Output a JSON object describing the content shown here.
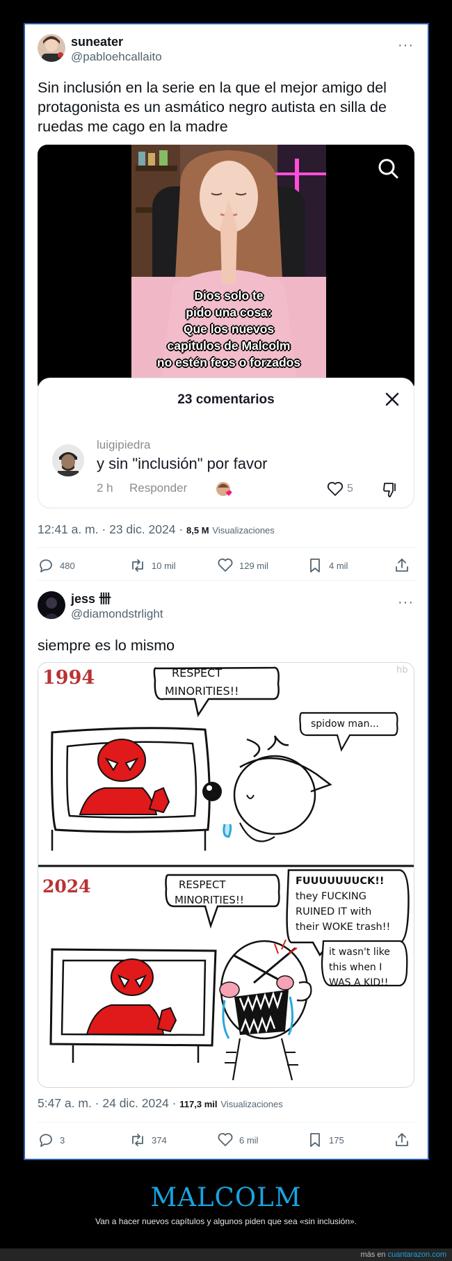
{
  "tweet1": {
    "display_name": "suneater",
    "handle": "@pabloehcallaito",
    "more_label": "···",
    "text": "Sin inclusión en la serie en la que el mejor amigo del protagonista es un asmático negro autista en silla de ruedas me cago en la madre",
    "video_caption": [
      "Dios solo te",
      "pido una cosa:",
      "Que los nuevos",
      "capitulos de Malcolm",
      "no estén feos o forzados"
    ],
    "comments_sheet": {
      "title": "23 comentarios",
      "comment": {
        "user": "luigipiedra",
        "text": "y sin \"inclusión\" por favor",
        "time": "2 h",
        "reply_label": "Responder",
        "likes": "5"
      }
    },
    "timestamp": "12:41 a. m. · 23 dic. 2024 · ",
    "views": "8,5 M",
    "views_label": "Visualizaciones",
    "stats": {
      "replies": "480",
      "retweets": "10 mil",
      "likes": "129 mil",
      "bookmarks": "4 mil"
    }
  },
  "tweet2": {
    "display_name": "jess 卌",
    "handle": "@diamondstrlight",
    "more_label": "···",
    "text": "siempre es lo mismo",
    "comic": {
      "year_top": "1994",
      "year_bottom": "2024",
      "bubble1": [
        "RESPECT",
        "MINORITIES!!"
      ],
      "bubble2": "spidow man...",
      "bubble3": [
        "RESPECT",
        "MINORITIES!!"
      ],
      "bubble4": [
        "FUUUUUUUCK!!",
        "they FUCKING",
        "RUINED IT with",
        "their WOKE trash!!"
      ],
      "bubble5": [
        "it wasn't like",
        "this when I",
        "WAS A KID!!"
      ],
      "watermark": "hb"
    },
    "timestamp": "5:47 a. m. · 24 dic. 2024 · ",
    "views": "117,3 mil",
    "views_label": "Visualizaciones",
    "stats": {
      "replies": "3",
      "retweets": "374",
      "likes": "6 mil",
      "bookmarks": "175"
    }
  },
  "post": {
    "title": "MALCOLM",
    "subtitle": "Van a hacer nuevos capítulos y algunos piden que sea «sin inclusión».",
    "footer_prefix": "más en ",
    "footer_link": "cuantarazon.com"
  },
  "colors": {
    "brand": "#1aa3e0",
    "card_border": "#2a5db0",
    "like_red": "#f91880"
  }
}
